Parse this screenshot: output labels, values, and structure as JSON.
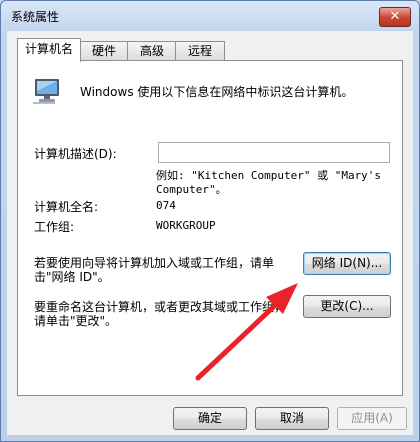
{
  "window": {
    "title": "系统属性",
    "close_glyph": "✕"
  },
  "tabs": [
    {
      "label": "计算机名",
      "active": true
    },
    {
      "label": "硬件",
      "active": false
    },
    {
      "label": "高级",
      "active": false
    },
    {
      "label": "远程",
      "active": false
    }
  ],
  "info_text": "Windows 使用以下信息在网络中标识这台计算机。",
  "description": {
    "label": "计算机描述(D):",
    "value": "",
    "example_line1": "例如: \"Kitchen Computer\" 或 \"Mary's",
    "example_line2": "Computer\"。"
  },
  "full_name": {
    "label": "计算机全名:",
    "value": "074"
  },
  "workgroup": {
    "label": "工作组:",
    "value": "WORKGROUP"
  },
  "network_id": {
    "text_line1": "若要使用向导将计算机加入域或工作组，请单",
    "text_line2": "击\"网络 ID\"。",
    "button": "网络 ID(N)..."
  },
  "rename": {
    "text_line1": "要重命名这台计算机，或者更改其域或工作组，",
    "text_line2": "请单击\"更改\"。",
    "button": "更改(C)..."
  },
  "footer": {
    "ok": "确定",
    "cancel": "取消",
    "apply": "应用(A)"
  },
  "icons": {
    "computer": "monitor-icon",
    "annotation": "red-arrow-icon"
  },
  "colors": {
    "arrow": "#e8242a",
    "titlebar": "#c4d6ee",
    "close": "#c9452f"
  }
}
